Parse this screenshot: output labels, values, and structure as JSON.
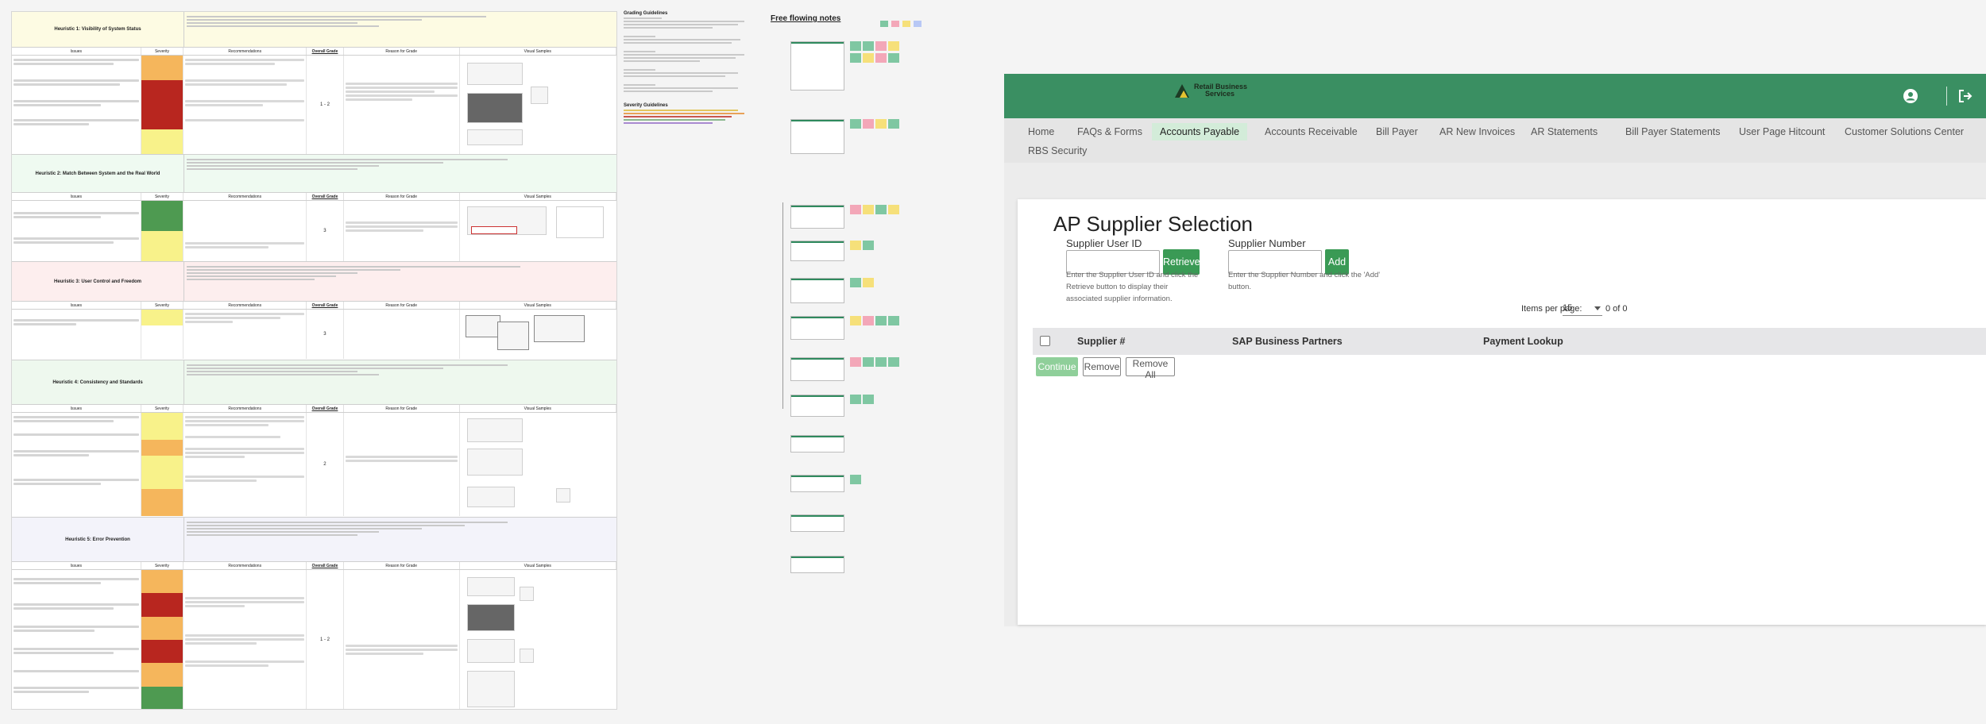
{
  "heuristics": [
    {
      "title": "Heuristic 1: Visibility of System Status",
      "grade": "1 - 2"
    },
    {
      "title": "Heuristic 2: Match Between System and the Real World",
      "grade": "3"
    },
    {
      "title": "Heuristic 3: User Control and Freedom",
      "grade": "3"
    },
    {
      "title": "Heuristic 4: Consistency and Standards",
      "grade": "2"
    },
    {
      "title": "Heuristic 5: Error Prevention",
      "grade": "1 - 2"
    }
  ],
  "columns": [
    "Issues",
    "Severity",
    "Recommendations",
    "Overall Grade",
    "Reason for Grade",
    "Visual Samples"
  ],
  "guidelines": {
    "title": "Grading Guidelines",
    "severity_title": "Severity Guidelines"
  },
  "notes": {
    "title": "Free flowing notes",
    "sticky_colors": [
      "#7fc7a2",
      "#f3a7b8",
      "#f6e07a",
      "#b8c8f5"
    ]
  },
  "app": {
    "brand_line1": "Retail Business",
    "brand_line2": "Services",
    "nav": [
      "Home",
      "FAQs & Forms",
      "Accounts Payable",
      "Accounts Receivable",
      "Bill Payer",
      "AR New Invoices",
      "AR Statements",
      "Bill Payer Statements",
      "User Page Hitcount",
      "Customer Solutions Center",
      "RBS Security"
    ],
    "nav_active": "Accounts Payable",
    "page_title": "AP Supplier Selection",
    "supplier_user_id_label": "Supplier User ID",
    "supplier_user_id_value": "",
    "retrieve_label": "Retrieve",
    "retrieve_hint": "Enter the Supplier User ID and click the Retrieve button to display their associated supplier information.",
    "supplier_number_label": "Supplier Number",
    "supplier_number_value": "",
    "add_label": "Add",
    "add_hint": "Enter the Supplier Number and click the 'Add' button.",
    "items_per_page_label": "Items per page:",
    "items_per_page_value": "15",
    "range_text": "0 of 0",
    "table_headers": [
      "Supplier #",
      "SAP Business Partners",
      "Payment Lookup"
    ],
    "continue_label": "Continue",
    "remove_label": "Remove",
    "remove_all_label": "Remove All",
    "colors": {
      "header_green": "#3a8f62",
      "button_green": "#3a9a55",
      "nav_active_bg": "#d3ecd9"
    }
  }
}
